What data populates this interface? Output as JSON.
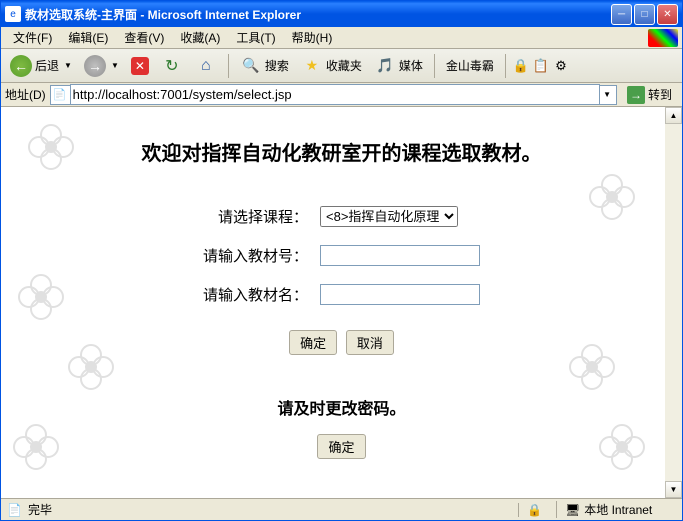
{
  "titlebar": {
    "text": "教材选取系统-主界面 - Microsoft Internet Explorer"
  },
  "menu": {
    "file": "文件(F)",
    "edit": "编辑(E)",
    "view": "查看(V)",
    "favorites": "收藏(A)",
    "tools": "工具(T)",
    "help": "帮助(H)"
  },
  "toolbar": {
    "back": "后退",
    "search": "搜索",
    "favorites": "收藏夹",
    "media": "媒体",
    "kingsoft": "金山毒霸"
  },
  "addressbar": {
    "label": "地址(D)",
    "url": "http://localhost:7001/system/select.jsp",
    "go": "转到"
  },
  "page": {
    "heading": "欢迎对指挥自动化教研室开的课程选取教材。",
    "course_label": "请选择课程：",
    "course_selected": "<8>指挥自动化原理",
    "material_id_label": "请输入教材号：",
    "material_id_value": "",
    "material_name_label": "请输入教材名：",
    "material_name_value": "",
    "submit": "确定",
    "cancel": "取消",
    "password_notice": "请及时更改密码。",
    "password_btn": "确定"
  },
  "statusbar": {
    "done": "完毕",
    "zone": "本地 Intranet"
  }
}
